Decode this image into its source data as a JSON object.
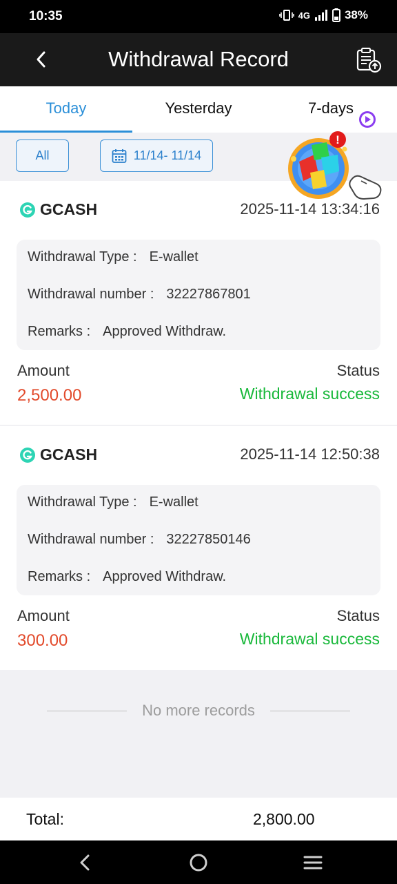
{
  "status_bar": {
    "time": "10:35",
    "network": "4G",
    "battery": "38%"
  },
  "header": {
    "title": "Withdrawal Record",
    "back_icon": "chevron-left-icon",
    "action_icon": "clipboard-upload-icon"
  },
  "tabs": [
    {
      "label": "Today",
      "active": true
    },
    {
      "label": "Yesterday",
      "active": false
    },
    {
      "label": "7-days",
      "active": false
    }
  ],
  "filters": {
    "all_label": "All",
    "date_range": "11/14- 11/14"
  },
  "records": [
    {
      "brand": "GCASH",
      "datetime": "2025-11-14 13:34:16",
      "type_label": "Withdrawal Type :",
      "type_value": "E-wallet",
      "number_label": "Withdrawal number :",
      "number_value": "32227867801",
      "remarks_label": "Remarks :",
      "remarks_value": "Approved Withdraw.",
      "amount_label": "Amount",
      "amount_value": "2,500.00",
      "status_label": "Status",
      "status_value": "Withdrawal success"
    },
    {
      "brand": "GCASH",
      "datetime": "2025-11-14 12:50:38",
      "type_label": "Withdrawal Type :",
      "type_value": "E-wallet",
      "number_label": "Withdrawal number :",
      "number_value": "32227850146",
      "remarks_label": "Remarks :",
      "remarks_value": "Approved Withdraw.",
      "amount_label": "Amount",
      "amount_value": "300.00",
      "status_label": "Status",
      "status_value": "Withdrawal success"
    }
  ],
  "footer_note": "No more records",
  "total": {
    "label": "Total:",
    "value": "2,800.00"
  },
  "colors": {
    "accent": "#2b8fd8",
    "amount": "#e24a2b",
    "success": "#18b83a",
    "header_bg": "#1a1a1a",
    "gcash": "#2dd4b4"
  }
}
